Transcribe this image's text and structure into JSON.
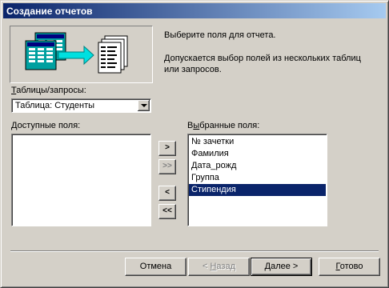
{
  "window": {
    "title": "Создание отчетов"
  },
  "instructions": {
    "line1": "Выберите поля для отчета.",
    "line2a": "Допускается выбор полей из нескольких таблиц",
    "line2b": "или запросов."
  },
  "source": {
    "label_mnemonic": "Т",
    "label_rest": "аблицы/запросы:",
    "selected": "Таблица: Студенты"
  },
  "available": {
    "label_mnemonic": "Д",
    "label_rest": "оступные поля:",
    "items": []
  },
  "selected_fields": {
    "label_pre": "В",
    "label_mnemonic": "ы",
    "label_rest": "бранные поля:",
    "items": [
      {
        "label": "№ зачетки",
        "selected": false
      },
      {
        "label": "Фамилия",
        "selected": false
      },
      {
        "label": "Дата_рожд",
        "selected": false
      },
      {
        "label": "Группа",
        "selected": false
      },
      {
        "label": "Стипендия",
        "selected": true
      }
    ]
  },
  "move_buttons": {
    "add_one": ">",
    "add_all": ">>",
    "remove_one": "<",
    "remove_all": "<<"
  },
  "footer": {
    "cancel": "Отмена",
    "back_arrow": "< ",
    "back_mnemonic": "Н",
    "back_rest": "азад",
    "next_mnemonic": "Д",
    "next_rest": "алее >",
    "finish_mnemonic": "Г",
    "finish_rest": "отово"
  },
  "colors": {
    "title_start": "#0a246a",
    "title_end": "#a6caf0",
    "selection": "#0a246a",
    "arrow": "#00e0e0"
  }
}
